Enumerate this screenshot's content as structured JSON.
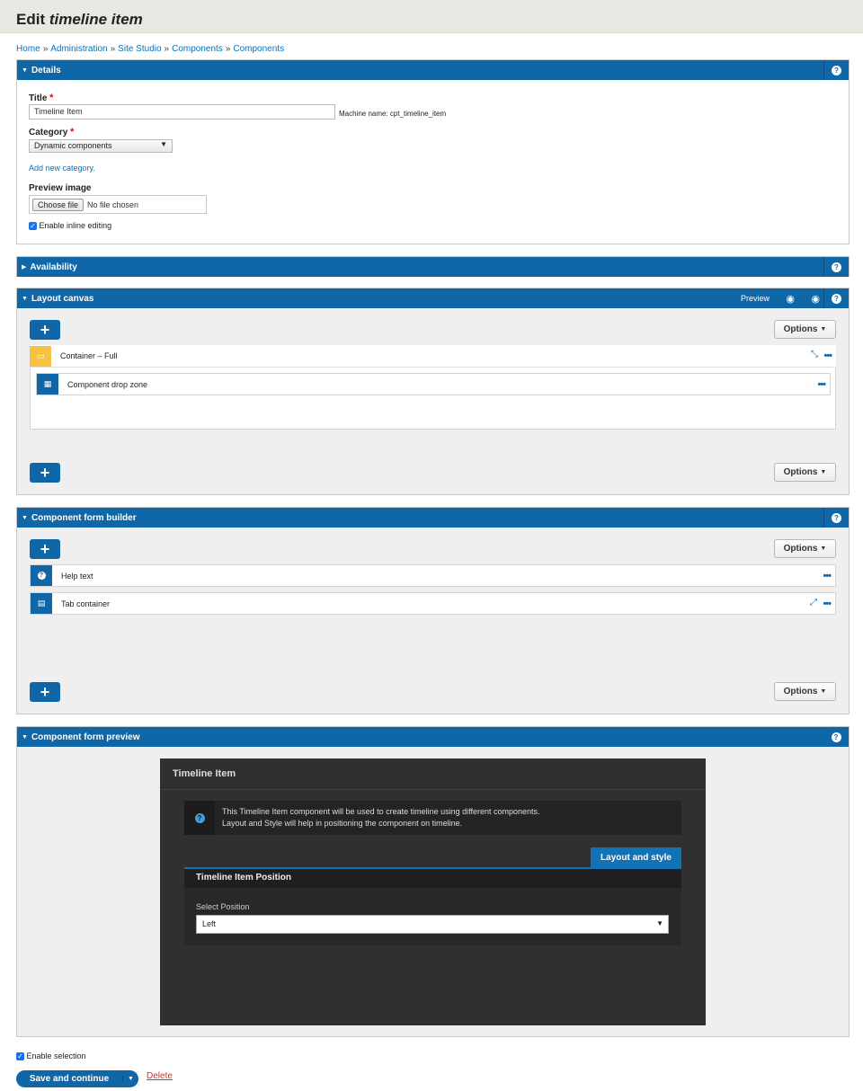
{
  "header": {
    "prefix": "Edit",
    "title_em": "timeline item"
  },
  "breadcrumb": [
    "Home",
    "Administration",
    "Site Studio",
    "Components",
    "Components"
  ],
  "breadcrumb_sep": "»",
  "details": {
    "heading": "Details",
    "title_label": "Title",
    "title_value": "Timeline Item",
    "machine_name": "Machine name: cpt_timeline_item",
    "category_label": "Category",
    "category_value": "Dynamic components",
    "add_category": "Add new category.",
    "preview_image_label": "Preview image",
    "choose_file": "Choose file",
    "no_file": "No file chosen",
    "inline_editing": "Enable inline editing"
  },
  "availability": {
    "heading": "Availability"
  },
  "layout_canvas": {
    "heading": "Layout canvas",
    "preview_label": "Preview",
    "options": "Options",
    "container": "Container – Full",
    "drop_zone": "Component drop zone"
  },
  "form_builder": {
    "heading": "Component form builder",
    "options": "Options",
    "help_text": "Help text",
    "tab_container": "Tab container"
  },
  "form_preview": {
    "heading": "Component form preview",
    "title": "Timeline Item",
    "help_line1": "This Timeline Item component will be used to create timeline using different components.",
    "help_line2": "Layout and Style will help in positioning the component on timeline.",
    "tab": "Layout and style",
    "section": "Timeline Item Position",
    "select_label": "Select Position",
    "select_value": "Left"
  },
  "footer": {
    "enable_selection": "Enable selection",
    "save": "Save and continue",
    "delete": "Delete"
  },
  "colors": {
    "accent": "#0f67a8",
    "container_icon": "#f5c242",
    "danger": "#c0392b"
  }
}
